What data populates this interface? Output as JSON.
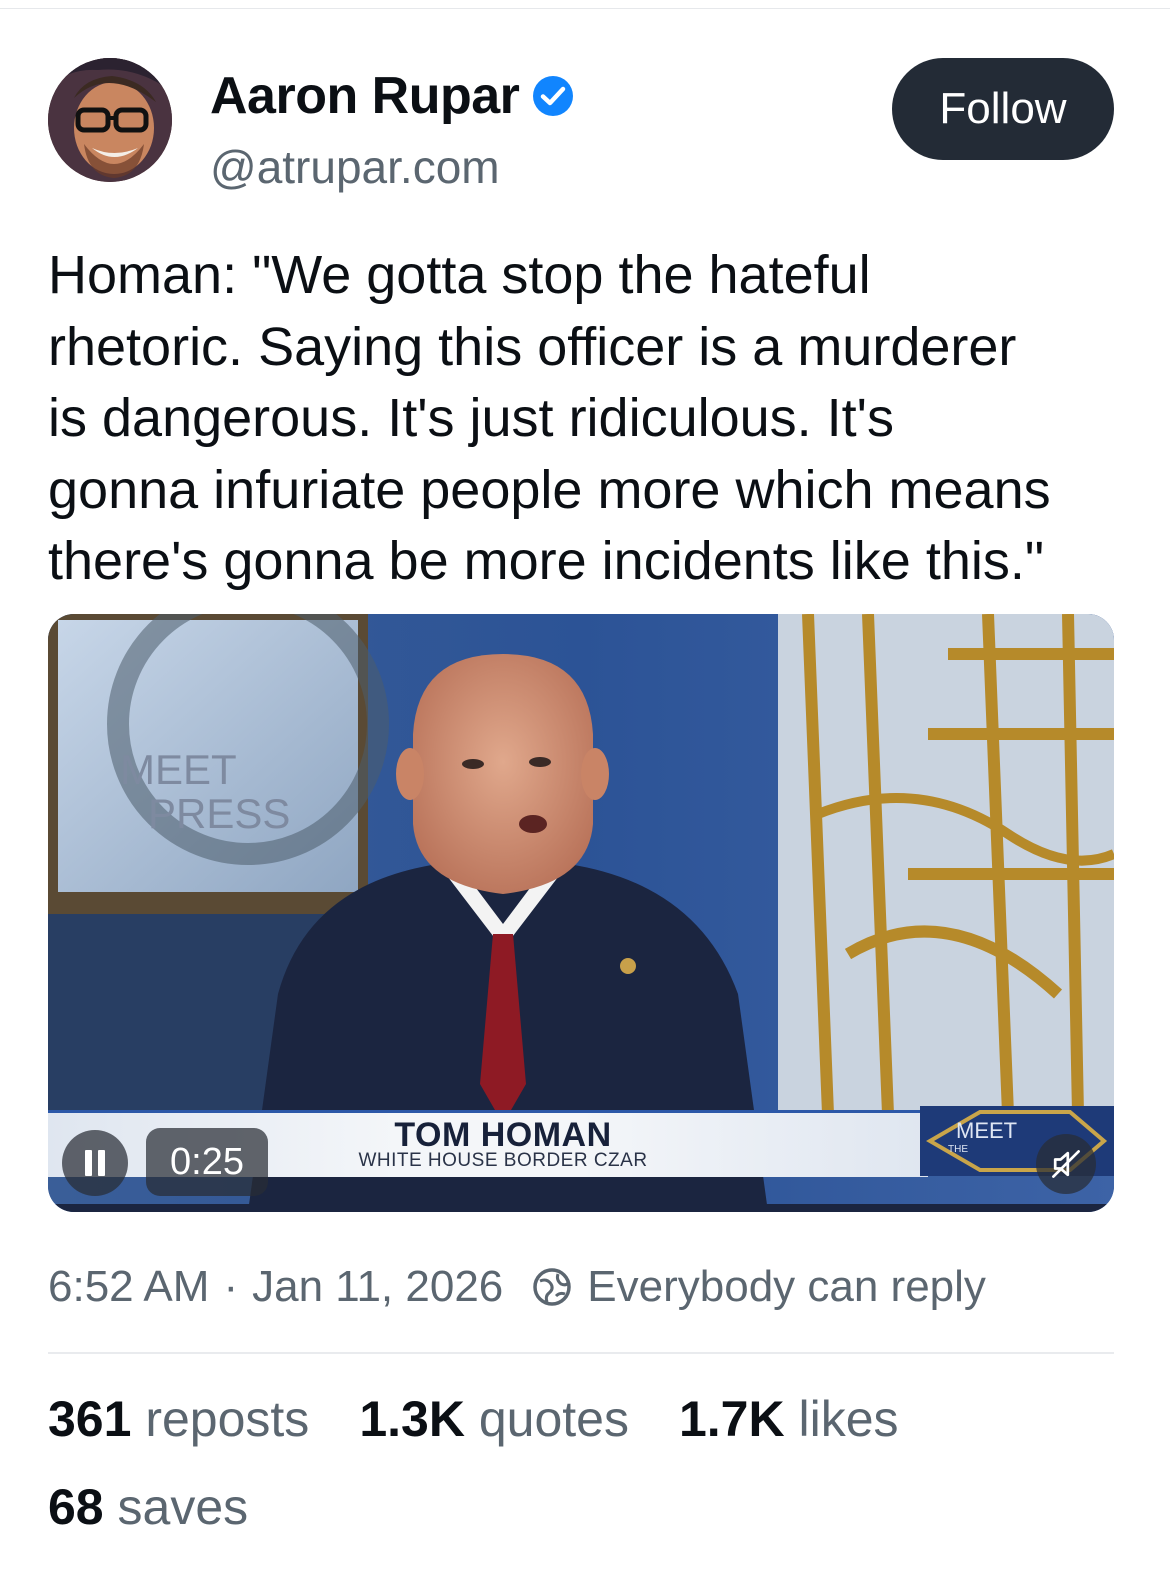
{
  "author": {
    "display_name": "Aaron Rupar",
    "handle": "@atrupar.com",
    "verified": true,
    "avatar_icon": "avatar-photo"
  },
  "follow_label": "Follow",
  "post": {
    "text": "Homan: \"We gotta stop the hateful\nrhetoric. Saying this officer is a murderer\nis dangerous. It's just ridiculous. It's\ngonna infuriate people more which means\nthere's gonna be more incidents like this.\""
  },
  "video": {
    "set_logo_text_1": "MEET",
    "set_logo_text_2": "PRESS",
    "set_logo_text_small": "THE",
    "lower_third_name": "TOM HOMAN",
    "lower_third_title": "WHITE HOUSE BORDER CZAR",
    "elapsed": "0:25",
    "state": "playing",
    "muted": true
  },
  "meta": {
    "time": "6:52 AM",
    "separator": "·",
    "date": "Jan 11, 2026",
    "reply_setting": "Everybody can reply"
  },
  "stats": {
    "reposts_count": "361",
    "reposts_label": "reposts",
    "quotes_count": "1.3K",
    "quotes_label": "quotes",
    "likes_count": "1.7K",
    "likes_label": "likes",
    "saves_count": "68",
    "saves_label": "saves"
  },
  "colors": {
    "follow_bg": "#232b36",
    "verified_blue": "#1185fe",
    "secondary_text": "#5b6670"
  }
}
